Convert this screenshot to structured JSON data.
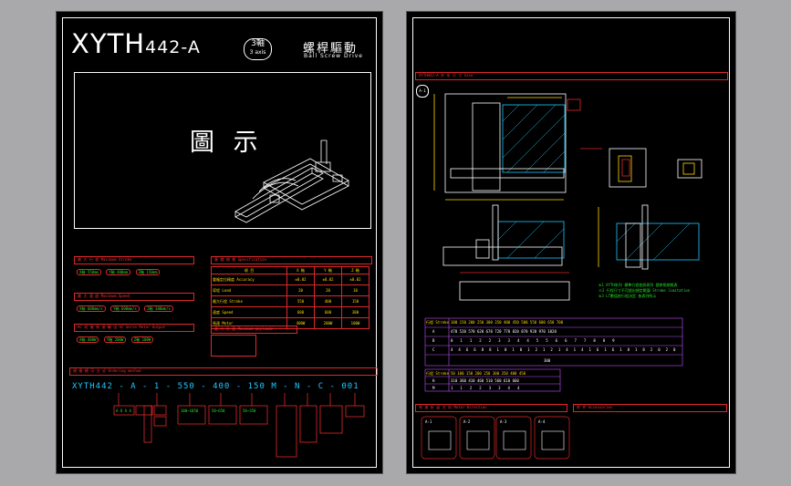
{
  "left_sheet": {
    "model": "XYTH",
    "model_suffix": "442-A",
    "axis_count": "3軸",
    "axis_count_en": "3 axis",
    "drive_title": "螺桿驅動",
    "drive_subtitle": "Ball Screw Drive",
    "illustration_label": "圖 示",
    "section_stroke": "最 大 行 程  Maximum Stroke",
    "section_speed": "最 大 速 度  Maximum Speed",
    "section_payload": "AC 伺 服 馬 達 輸 出  AC Servo Motor Output",
    "section_spec": "基 礎 規 格  Specification",
    "section_payload2": "最 大 負 載  Maximum payloads",
    "ordering_section": "規 格 標 示 方 式  Ordering method",
    "ordering_code": [
      "XYTH442 - A",
      "1",
      "550",
      "400",
      "150",
      "M",
      "N",
      "C",
      "001"
    ],
    "stroke_items": [
      "X軸 550mm",
      "Y軸 400mm",
      "Z軸 150mm"
    ],
    "speed_items": [
      "X軸 600mm/s",
      "Y軸 600mm/s",
      "Z軸 300mm/s"
    ],
    "motor_items": [
      "X軸 400W",
      "Y軸 200W",
      "Z軸 100W"
    ],
    "spec_headers": [
      "項 目",
      "X 軸",
      "Y 軸",
      "Z 軸"
    ],
    "spec_rows": [
      [
        "重複定位精度  Accuracy",
        "±0.02",
        "±0.02",
        "±0.02"
      ],
      [
        "導程  Lead",
        "20",
        "20",
        "10"
      ],
      [
        "最大行程  Stroke",
        "550",
        "400",
        "150"
      ],
      [
        "速度  Speed",
        "600",
        "600",
        "300"
      ],
      [
        "馬達  Motor",
        "400W",
        "200W",
        "100W"
      ]
    ]
  },
  "right_sheet": {
    "header": "XYTH442-A 外 形 尺 寸 Size",
    "view_tag": "A-1",
    "section_a_label": "A",
    "note_lines": [
      "※1  XYTH系列 標準行程依照表列 請參照規格表",
      "※2  行程尺寸不可超出規定範圍 Stroke limitation",
      "※3  LT數值依行程決定 依表列所示"
    ],
    "table1_header_left": "行程 Stroke",
    "table1_rows": [
      [
        "100",
        "150",
        "200",
        "250",
        "300",
        "350",
        "400",
        "450",
        "500",
        "550",
        "600",
        "650",
        "700",
        "750",
        "800",
        "850",
        "900",
        "950",
        "1000"
      ],
      [
        "A",
        "470",
        "520",
        "570",
        "620",
        "670",
        "720",
        "770",
        "820",
        "870",
        "920",
        "970",
        "1020",
        "1070",
        "1120",
        "1170",
        "1220",
        "1270",
        "1320"
      ],
      [
        "B",
        "0",
        "1",
        "1",
        "2",
        "2",
        "3",
        "3",
        "4",
        "4",
        "5",
        "5",
        "6",
        "6",
        "7",
        "7",
        "8",
        "8",
        "9"
      ],
      [
        "C",
        "4",
        "4",
        "6",
        "6",
        "8",
        "8",
        "10",
        "10",
        "12",
        "12",
        "14",
        "14",
        "16",
        "16",
        "18",
        "18",
        "20",
        "20"
      ]
    ],
    "table1_footer": "300",
    "table2_header_left": "行程 Stroke",
    "table2_rows": [
      [
        "50",
        "100",
        "150",
        "200",
        "250",
        "300",
        "350",
        "400",
        "450"
      ],
      [
        "H",
        "310",
        "360",
        "410",
        "460",
        "510",
        "560",
        "610",
        "660"
      ],
      [
        "M",
        "1",
        "1",
        "2",
        "2",
        "3",
        "3",
        "4",
        "4"
      ]
    ],
    "section_motor": "馬 達 折 返 方 向  Motor Direction",
    "section_acc": "附 件  Accessories",
    "motor_options": [
      "A-1",
      "A-2",
      "A-3",
      "A-4"
    ]
  }
}
